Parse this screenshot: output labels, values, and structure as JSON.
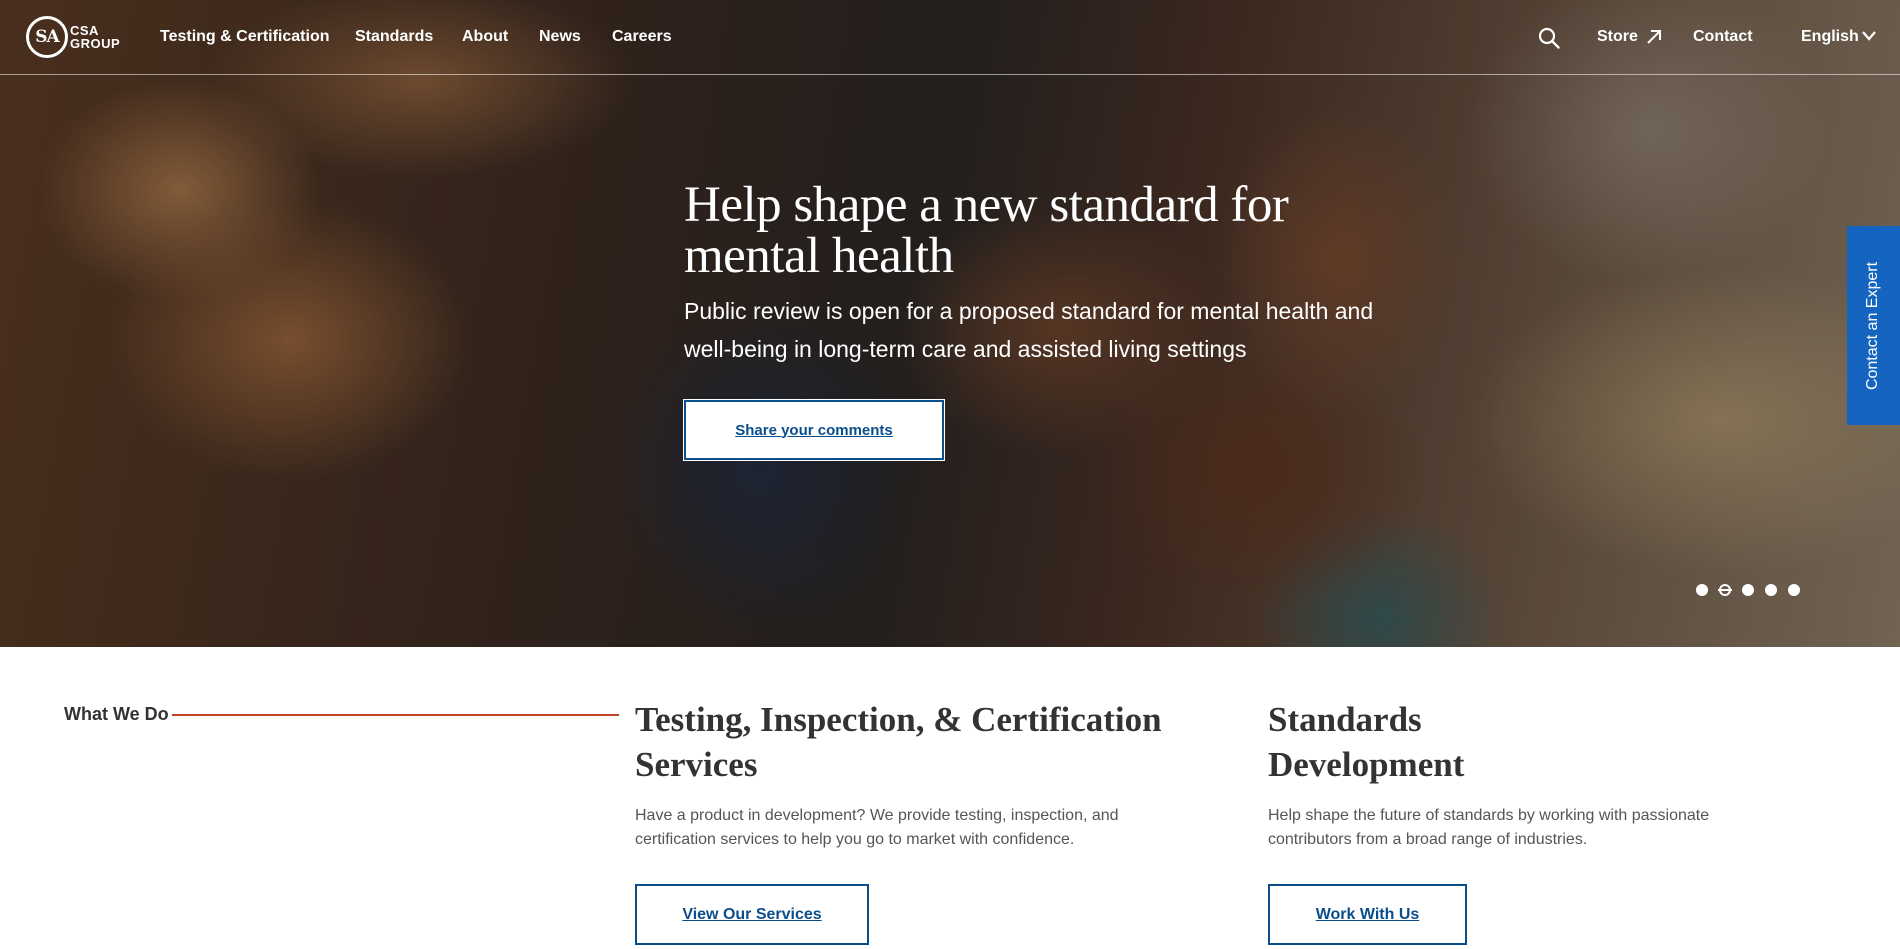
{
  "brand": {
    "mark": "SA",
    "line1": "CSA",
    "line2": "GROUP"
  },
  "nav": {
    "items": [
      "Testing & Certification",
      "Standards",
      "About",
      "News",
      "Careers"
    ],
    "store": "Store",
    "contact": "Contact",
    "language": "English"
  },
  "hero": {
    "title": "Help shape a new standard for mental health",
    "subtitle": "Public review is open for a proposed standard for mental health and well-being in long-term care and assisted living settings",
    "cta": "Share your comments",
    "slide_count": 5,
    "active_slide": 2
  },
  "side_tab": "Contact an Expert",
  "what_we_do": {
    "label": "What We Do",
    "cards": [
      {
        "title": "Testing, Inspection, & Certification Services",
        "text": "Have a product in development? We provide testing, inspection, and certification services to help you go to market with confidence.",
        "cta": "View Our Services"
      },
      {
        "title": "Standards Development",
        "text": "Help shape the future of standards by working with passionate contributors from a broad range of industries.",
        "cta": "Work With Us"
      }
    ]
  },
  "colors": {
    "accent": "#0b4e8c",
    "side_tab": "#1565c0",
    "rule": "#c0432a"
  },
  "icons": [
    "search-icon",
    "external-arrow-icon",
    "chevron-down-icon"
  ]
}
